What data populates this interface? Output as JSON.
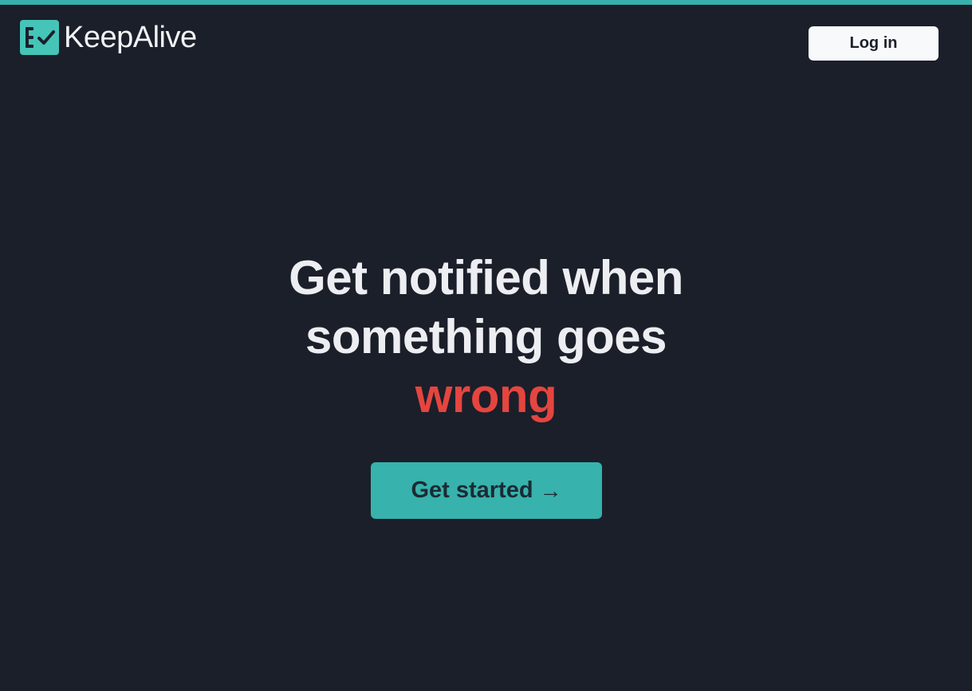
{
  "colors": {
    "background": "#1b1f2a",
    "accent": "#37b2ac",
    "logo": "#45c4b8",
    "headline": "#eceef1",
    "highlight": "#e5453f",
    "login_bg": "#f8f9fb"
  },
  "header": {
    "logo_icon": "checklist-icon",
    "brand_name": "KeepAlive",
    "login_label": "Log in"
  },
  "hero": {
    "headline_line1": "Get notified when",
    "headline_line2": "something goes",
    "headline_highlight": "wrong",
    "cta_label": "Get started",
    "cta_icon": "arrow-right-icon",
    "cta_arrow": "→"
  }
}
